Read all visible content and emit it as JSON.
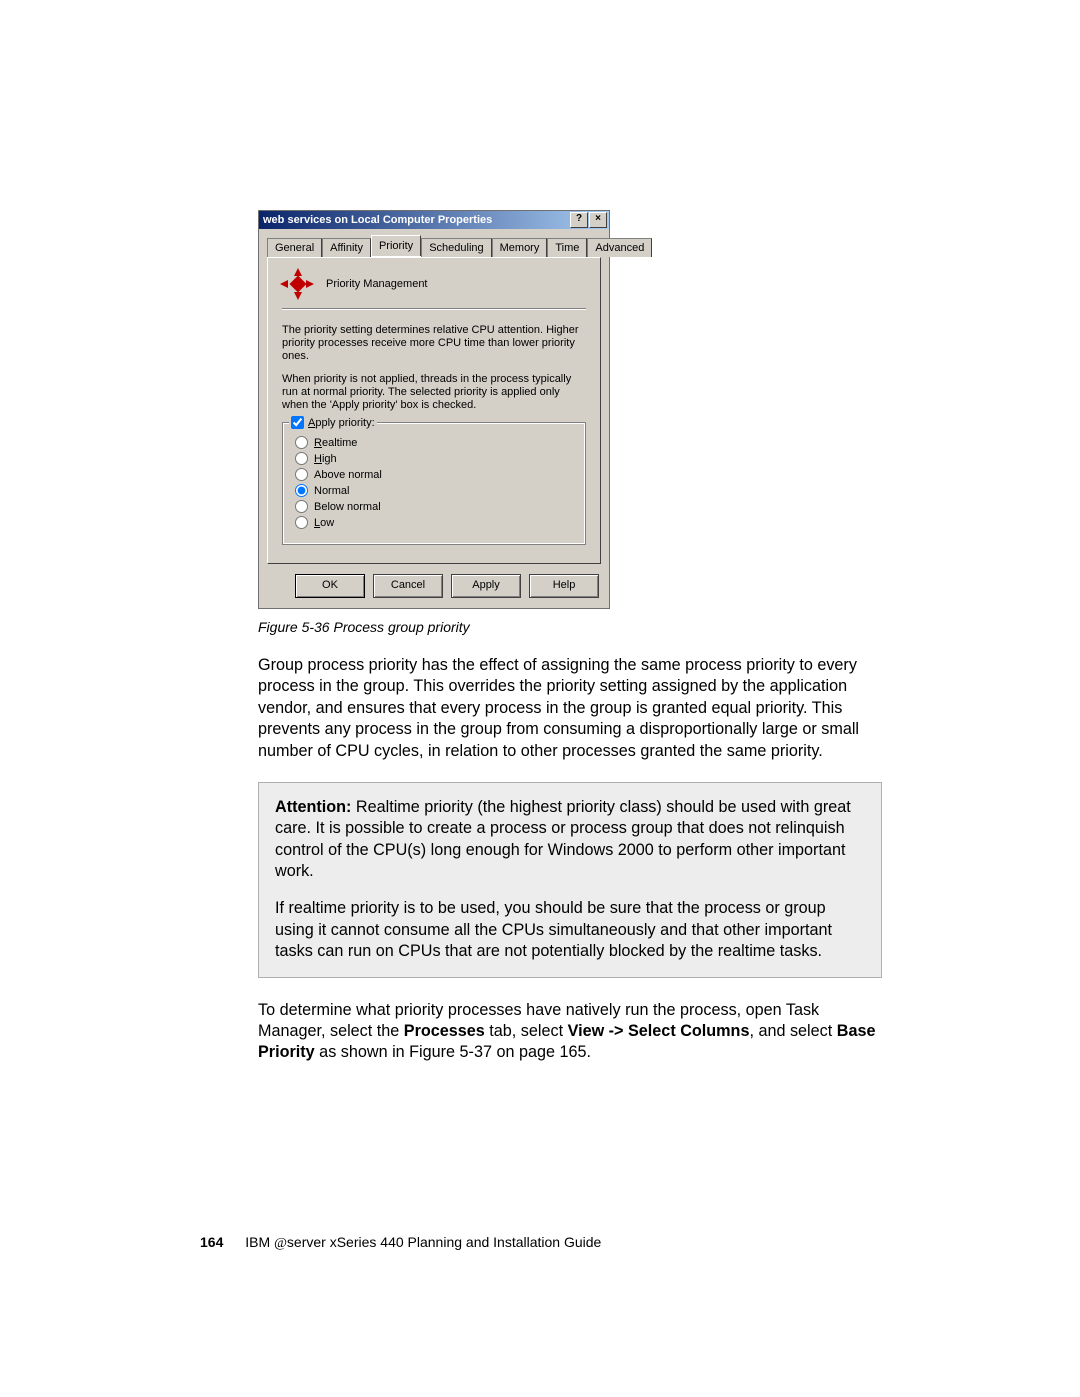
{
  "dialog": {
    "title": "web services on Local Computer Properties",
    "help_btn": "?",
    "close_btn": "×",
    "tabs": {
      "general": "General",
      "affinity": "Affinity",
      "priority": "Priority",
      "scheduling": "Scheduling",
      "memory": "Memory",
      "time": "Time",
      "advanced": "Advanced"
    },
    "panel": {
      "heading": "Priority Management",
      "desc1": "The priority setting determines relative CPU attention.  Higher priority processes receive more CPU time than lower priority ones.",
      "desc2": "When priority is not applied, threads in the process typically run at normal priority.  The selected priority is applied only when the 'Apply priority' box is checked.",
      "apply_label": "Apply priority:",
      "apply_checked": true,
      "options": {
        "realtime": "Realtime",
        "high": "High",
        "above": "Above normal",
        "normal": "Normal",
        "below": "Below normal",
        "low": "Low"
      },
      "selected": "normal"
    },
    "buttons": {
      "ok": "OK",
      "cancel": "Cancel",
      "apply": "Apply",
      "help": "Help"
    }
  },
  "caption": "Figure 5-36   Process group priority",
  "para1": "Group process priority has the effect of assigning the same process priority to every process in the group. This overrides the priority setting assigned by the application vendor, and ensures that every process in the group is granted equal priority. This prevents any process in the group from consuming a disproportionally large or small number of CPU cycles, in relation to other processes granted the same priority.",
  "attention": {
    "p1_lead": "Attention:",
    "p1_rest": " Realtime priority (the highest priority class) should be used with great care. It is possible to create a process or process group that does not relinquish control of the CPU(s) long enough for Windows 2000 to perform other important work.",
    "p2": "If realtime priority is to be used, you should be sure that the process or group using it cannot consume all the CPUs simultaneously and that other important tasks can run on CPUs that are not potentially blocked by the realtime tasks."
  },
  "para2_a": "To determine what priority processes have natively run the process, open Task Manager, select the ",
  "para2_b": "Processes",
  "para2_c": " tab, select ",
  "para2_d": "View -> Select Columns",
  "para2_e": ", and select ",
  "para2_f": "Base Priority",
  "para2_g": " as shown in Figure 5-37 on page 165.",
  "footer": {
    "page_no": "164",
    "book_a": "IBM ",
    "book_b": "server xSeries 440 Planning and Installation Guide"
  }
}
